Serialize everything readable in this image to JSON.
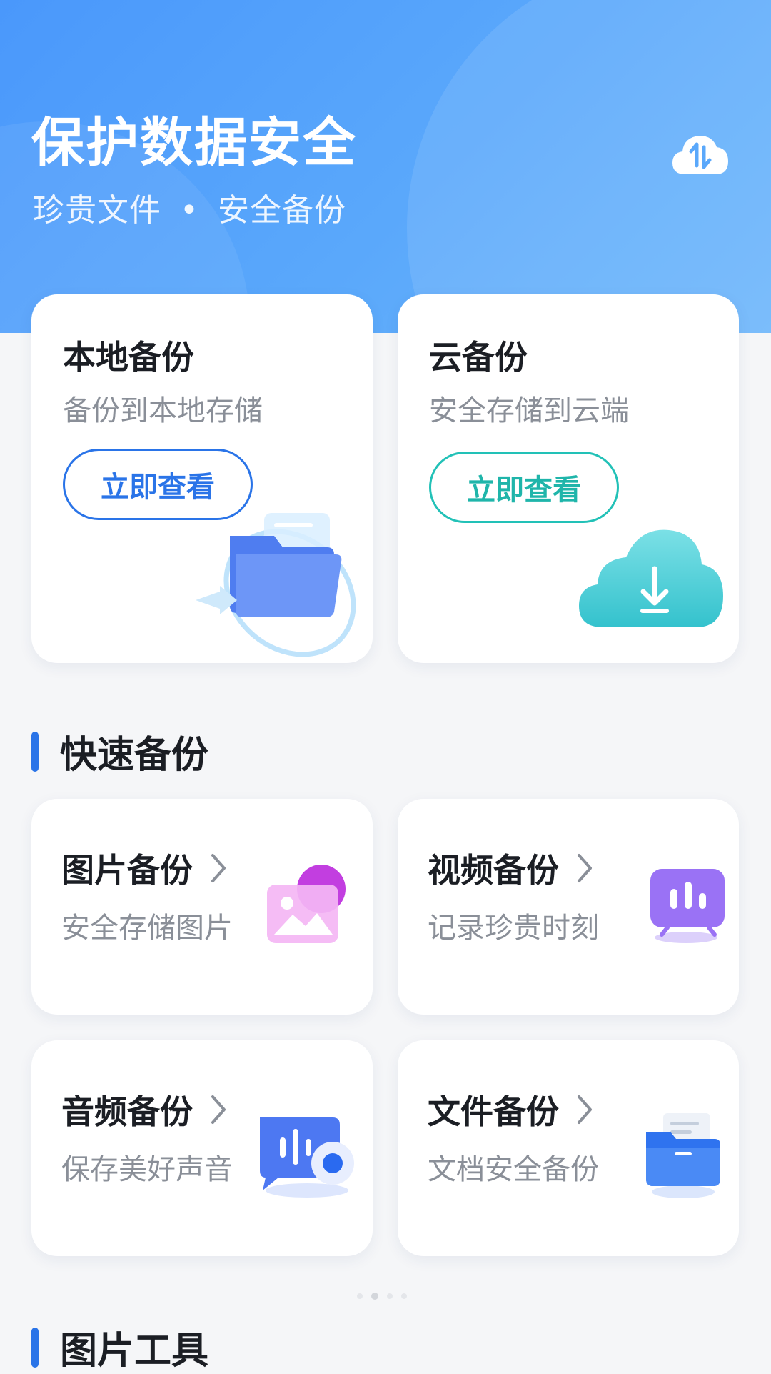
{
  "hero": {
    "title": "保护数据安全",
    "subtitle_left": "珍贵文件",
    "subtitle_dot": "•",
    "subtitle_right": "安全备份",
    "sync_icon": "cloud-sync-icon"
  },
  "backup_cards": [
    {
      "title": "本地备份",
      "subtitle": "备份到本地存储",
      "button": "立即查看",
      "accent": "#2a74e8",
      "icon": "folder-icon"
    },
    {
      "title": "云备份",
      "subtitle": "安全存储到云端",
      "button": "立即查看",
      "accent": "#1fb5aa",
      "icon": "cloud-download-icon"
    }
  ],
  "quick_backup": {
    "section_title": "快速备份",
    "items": [
      {
        "title": "图片备份",
        "subtitle": "安全存储图片",
        "icon": "image-icon"
      },
      {
        "title": "视频备份",
        "subtitle": "记录珍贵时刻",
        "icon": "video-icon"
      },
      {
        "title": "音频备份",
        "subtitle": "保存美好声音",
        "icon": "audio-icon"
      },
      {
        "title": "文件备份",
        "subtitle": "文档安全备份",
        "icon": "file-folder-icon"
      }
    ]
  },
  "image_tools": {
    "section_title": "图片工具"
  },
  "pager": {
    "count": 4,
    "active": 2
  },
  "colors": {
    "hero_blue": "#4a98fb",
    "accent_blue": "#2a74e8",
    "accent_teal": "#1fb5aa",
    "background": "#f5f6f8"
  }
}
